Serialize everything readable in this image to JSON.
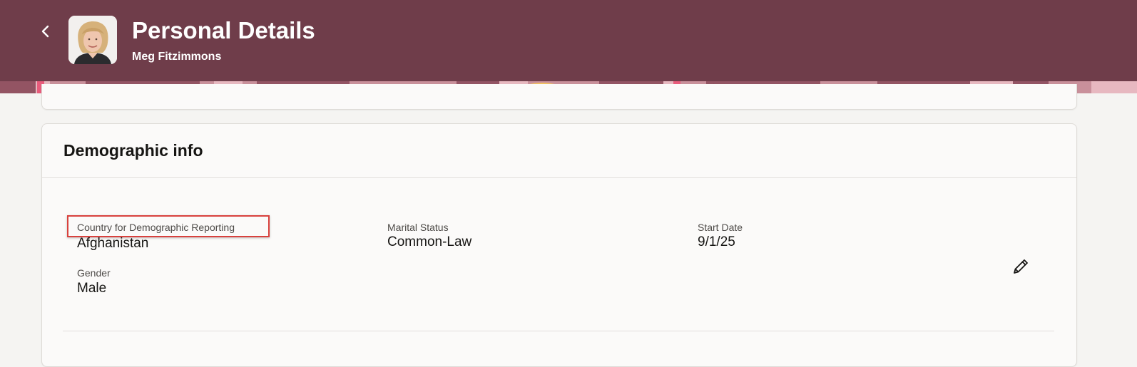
{
  "header": {
    "title": "Personal Details",
    "person_name": "Meg Fitzimmons",
    "background_color": "#6f3d4a",
    "back_icon": "chevron-left-icon",
    "avatar": "profile-photo"
  },
  "demographic_card": {
    "title": "Demographic info",
    "fields": [
      {
        "label": "Country for Demographic Reporting",
        "value": "Afghanistan",
        "highlighted": true
      },
      {
        "label": "Marital Status",
        "value": "Common-Law"
      },
      {
        "label": "Start Date",
        "value": "9/1/25"
      },
      {
        "label": "Gender",
        "value": "Male"
      }
    ],
    "edit_icon": "pencil-icon"
  },
  "colors": {
    "highlight": "#d9413d",
    "text": "#161513",
    "label": "#4e4b48"
  }
}
